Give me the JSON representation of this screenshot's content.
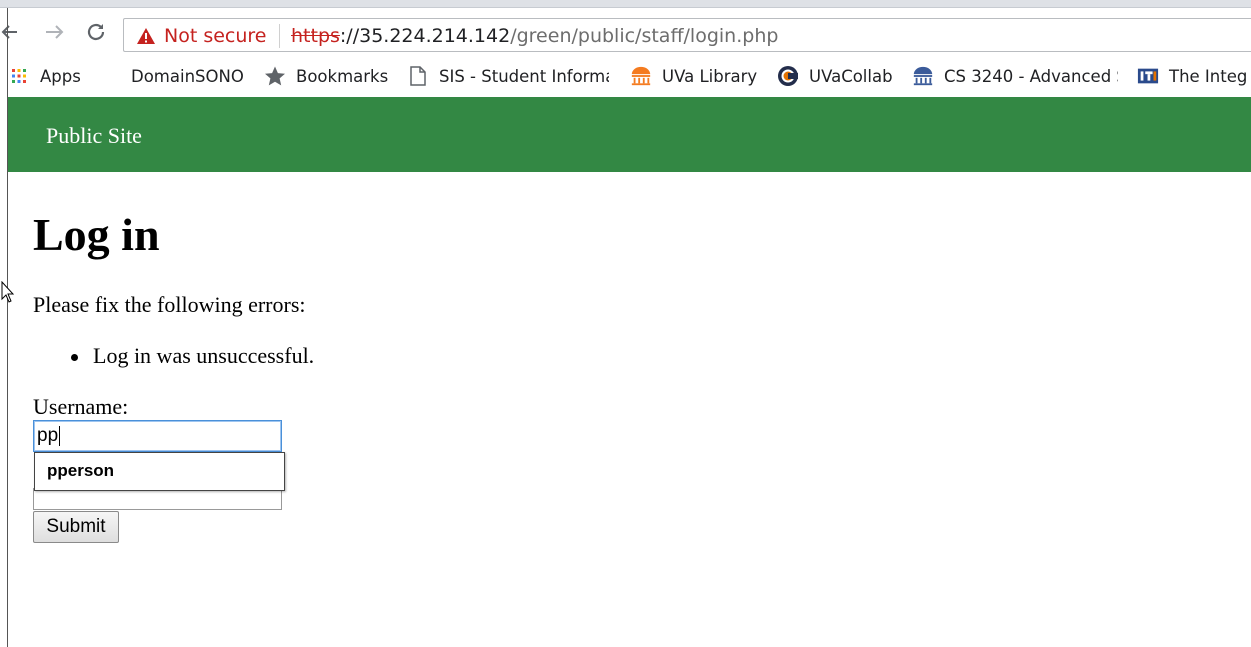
{
  "browser": {
    "security_label": "Not secure",
    "url": {
      "scheme": "https",
      "host": "://35.224.214.142",
      "path": "/green/public/staff/login.php"
    },
    "bookmarks": [
      {
        "label": "Apps",
        "icon": "apps-grid-icon"
      },
      {
        "label": "DomainSONO",
        "icon": "none"
      },
      {
        "label": "Bookmarks",
        "icon": "star-icon"
      },
      {
        "label": "SIS - Student Informa",
        "icon": "page-icon"
      },
      {
        "label": "UVa Library",
        "icon": "library-icon"
      },
      {
        "label": "UVaCollab",
        "icon": "collab-icon"
      },
      {
        "label": "CS 3240 - Advanced S",
        "icon": "rotunda-icon"
      },
      {
        "label": "The Integ",
        "icon": "its-icon"
      }
    ]
  },
  "site": {
    "header_title": "Public Site",
    "accent_color": "#338844"
  },
  "login": {
    "title": "Log in",
    "error_intro": "Please fix the following errors:",
    "errors": [
      "Log in was unsuccessful."
    ],
    "username_label": "Username:",
    "username_value": "pp",
    "autocomplete_suggestion": "pperson",
    "submit_label": "Submit"
  }
}
